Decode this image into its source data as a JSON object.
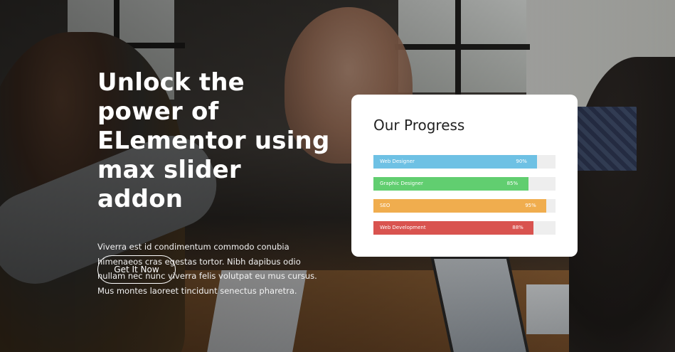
{
  "hero": {
    "headline_line1": "Unlock the power of",
    "headline_line2": "ELementor using",
    "headline_line3": "max slider addon",
    "description": "Viverra est id condimentum commodo conubia himenaeos cras egestas tortor. Nibh dapibus odio nullam nec nunc viverra felis volutpat eu mus cursus. Mus montes laoreet tincidunt senectus pharetra.",
    "cta_label": "Get It Now"
  },
  "progress_card": {
    "title": "Our Progress",
    "skills": [
      {
        "label": "Web Designer",
        "percent_text": "90%",
        "value": 90,
        "color": "#6ec1e4"
      },
      {
        "label": "Graphic Designer",
        "percent_text": "85%",
        "value": 85,
        "color": "#61ce70"
      },
      {
        "label": "SEO",
        "percent_text": "95%",
        "value": 95,
        "color": "#f0ad4e"
      },
      {
        "label": "Web Development",
        "percent_text": "88%",
        "value": 88,
        "color": "#d9534f"
      }
    ]
  }
}
